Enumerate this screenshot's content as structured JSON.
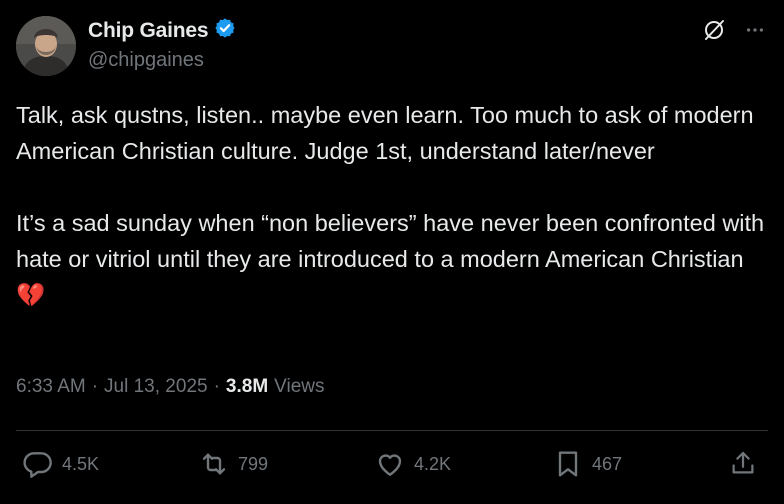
{
  "author": {
    "name": "Chip Gaines",
    "handle": "@chipgaines",
    "verified": true
  },
  "tweet": {
    "paragraph1": "Talk, ask qustns, listen.. maybe even learn. Too much to ask of modern American Christian culture. Judge 1st, understand later/never",
    "paragraph2": "It’s a sad sunday when “non believers” have never been confronted with hate or vitriol until they are introduced to a modern American Christian",
    "emoji": "💔"
  },
  "meta": {
    "time": "6:33 AM",
    "separator": "·",
    "date": "Jul 13, 2025",
    "views_count": "3.8M",
    "views_label": "Views"
  },
  "actions": {
    "replies": "4.5K",
    "reposts": "799",
    "likes": "4.2K",
    "bookmarks": "467"
  },
  "icons": {
    "verified_badge": "verified-badge-icon",
    "grok": "grok-icon",
    "more": "more-icon",
    "reply": "reply-icon",
    "repost": "repost-icon",
    "like": "heart-icon",
    "bookmark": "bookmark-icon",
    "share": "share-icon"
  },
  "colors": {
    "background": "#000000",
    "text": "#e7e9ea",
    "muted": "#71767b",
    "verified": "#1d9bf0",
    "divider": "#2f3336"
  }
}
